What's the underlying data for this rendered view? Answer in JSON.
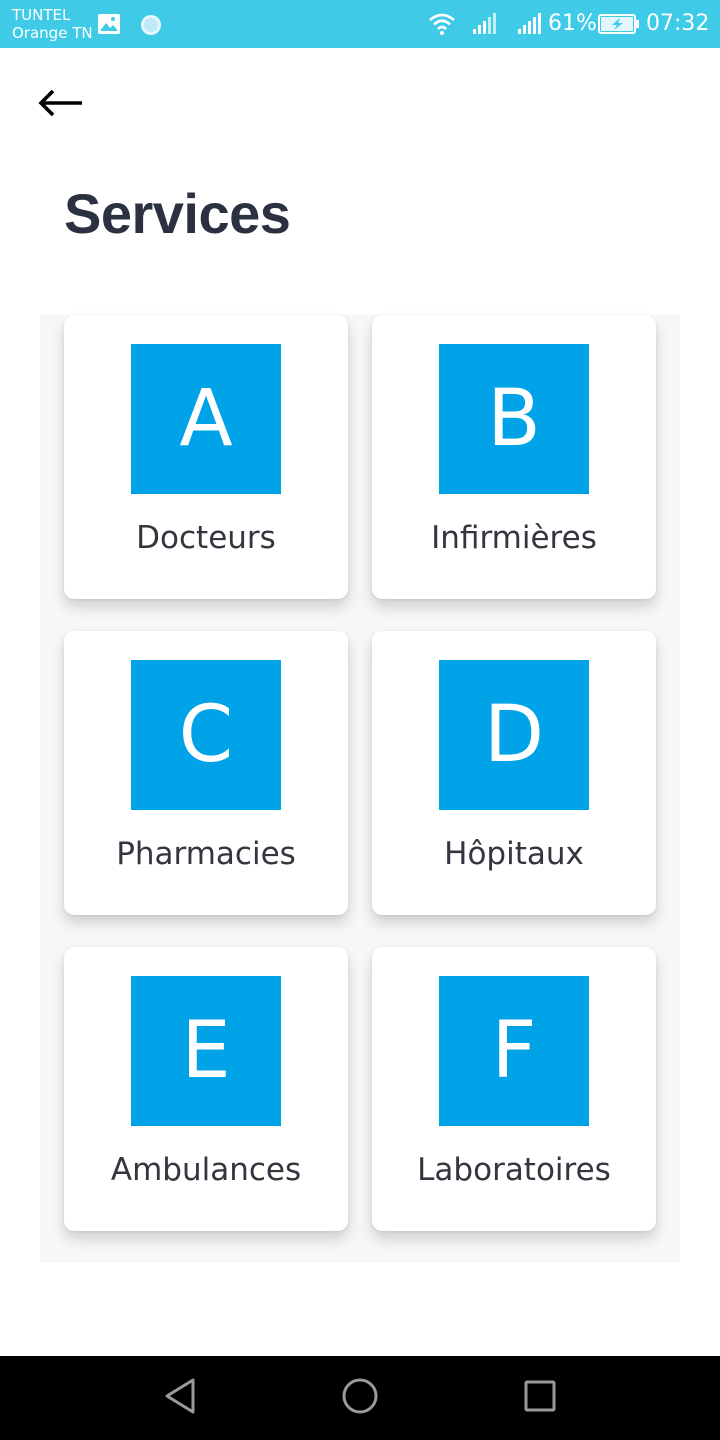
{
  "status_bar": {
    "carrier_line1": "TUNTEL",
    "carrier_line2": "Orange TN",
    "battery_percent": "61%",
    "time": "07:32",
    "icons": [
      "gallery-icon",
      "sync-icon",
      "wifi-icon",
      "signal-icon",
      "signal-icon",
      "battery-charging-icon"
    ]
  },
  "header": {
    "back_icon": "arrow-left-icon",
    "title": "Services"
  },
  "services": [
    {
      "letter": "A",
      "label": "Docteurs"
    },
    {
      "letter": "B",
      "label": "Infirmières"
    },
    {
      "letter": "C",
      "label": "Pharmacies"
    },
    {
      "letter": "D",
      "label": "Hôpitaux"
    },
    {
      "letter": "E",
      "label": "Ambulances"
    },
    {
      "letter": "F",
      "label": "Laboratoires"
    }
  ],
  "nav_bar": {
    "icons": [
      "back-triangle-icon",
      "home-circle-icon",
      "recents-square-icon"
    ]
  },
  "colors": {
    "status_bar": "#3fcbe8",
    "accent": "#00a2e8",
    "title_text": "#2c3142",
    "label_text": "#33363f",
    "nav_bar": "#000000"
  }
}
